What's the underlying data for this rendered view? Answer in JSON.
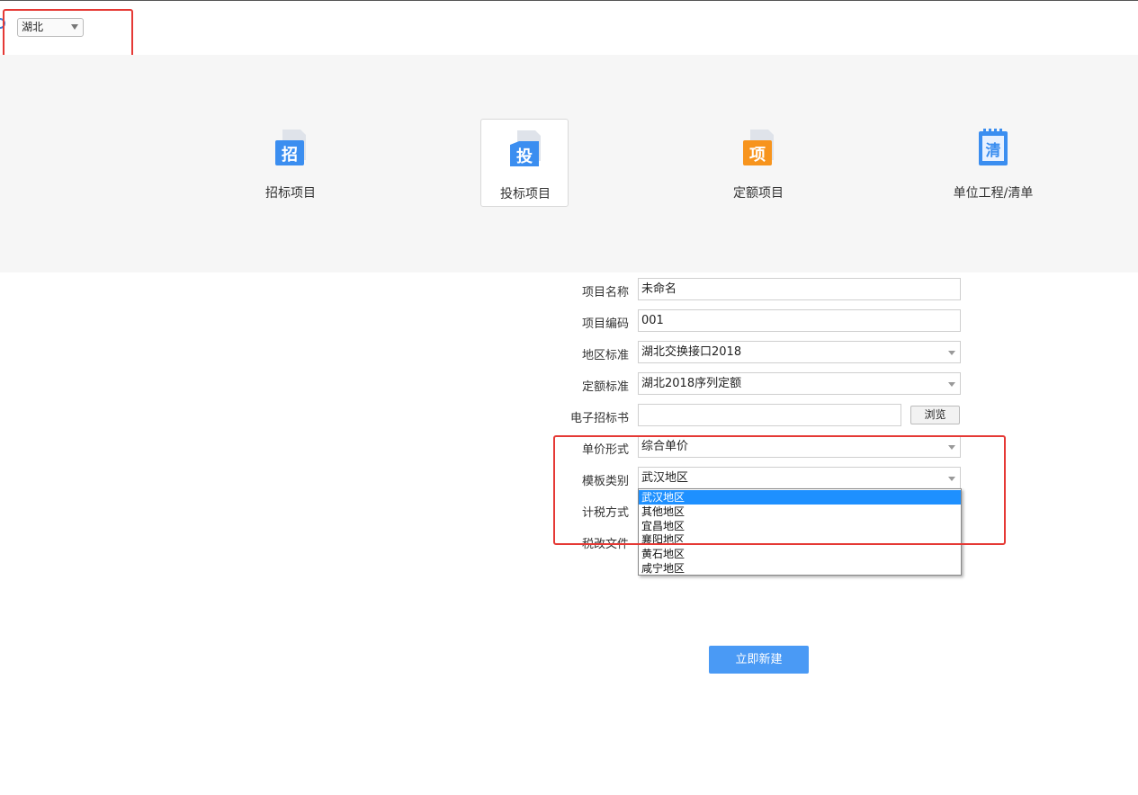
{
  "region_selector": {
    "value": "湖北"
  },
  "project_types": [
    {
      "label": "招标项目",
      "icon_char": "招",
      "icon": "zhaobiao-icon",
      "color": "#3b8ef0"
    },
    {
      "label": "投标项目",
      "icon_char": "投",
      "icon": "toubiao-icon",
      "color": "#3b8ef0"
    },
    {
      "label": "定额项目",
      "icon_char": "项",
      "icon": "dinge-icon",
      "color": "#f7941d"
    },
    {
      "label": "单位工程/清单",
      "icon_char": "清",
      "icon": "qingdan-icon",
      "color": "#3b8ef0"
    }
  ],
  "selected_type": "投标项目",
  "form": {
    "project_name": {
      "label": "项目名称",
      "value": "未命名"
    },
    "project_code": {
      "label": "项目编码",
      "value": "001"
    },
    "region_standard": {
      "label": "地区标准",
      "value": "湖北交换接口2018"
    },
    "quota_standard": {
      "label": "定额标准",
      "value": "湖北2018序列定额"
    },
    "e_tender_doc": {
      "label": "电子招标书",
      "value": "",
      "browse_label": "浏览"
    },
    "price_form": {
      "label": "单价形式",
      "value": "综合单价"
    },
    "template_category": {
      "label": "模板类别",
      "value": "武汉地区"
    },
    "tax_method": {
      "label": "计税方式"
    },
    "tax_reform_file": {
      "label": "税改文件"
    }
  },
  "template_options": [
    "武汉地区",
    "其他地区",
    "宜昌地区",
    "襄阳地区",
    "黄石地区",
    "咸宁地区"
  ],
  "create_button": "立即新建",
  "colors": {
    "accent": "#4a9af5",
    "highlight": "#e53935",
    "selection": "#1e90ff"
  }
}
